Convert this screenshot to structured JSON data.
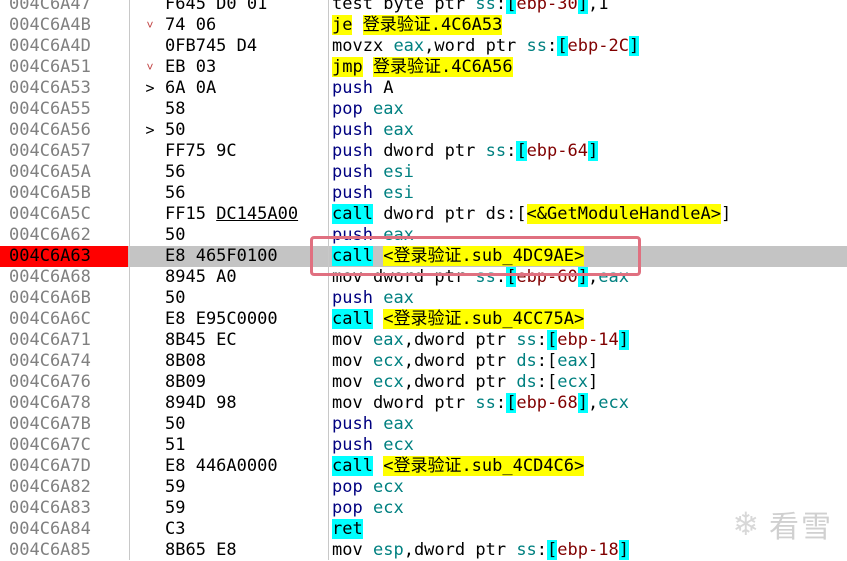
{
  "watermark": {
    "text": "看雪",
    "icon": "snowflake-icon"
  },
  "rows": [
    {
      "addr": "004C6A47",
      "jump": "",
      "bytes": "F645 D0 01",
      "tokens": [
        [
          "kw",
          "test"
        ],
        [
          "sp",
          " "
        ],
        [
          "kw",
          "byte ptr"
        ],
        [
          "sp",
          " "
        ],
        [
          "green",
          "ss"
        ],
        [
          "sp",
          ":"
        ],
        [
          "brk",
          "["
        ],
        [
          "red",
          "ebp-30"
        ],
        [
          "brk",
          "]"
        ],
        [
          "sp",
          ","
        ],
        [
          "kw",
          "1"
        ]
      ]
    },
    {
      "addr": "004C6A4B",
      "jump": "˅",
      "bytes": "74 06",
      "tokens": [
        [
          "yellow",
          "je"
        ],
        [
          "sp",
          " "
        ],
        [
          "yellow",
          "登录验证.4C6A53"
        ]
      ]
    },
    {
      "addr": "004C6A4D",
      "jump": "",
      "bytes": "0FB745 D4",
      "tokens": [
        [
          "kw",
          "movzx"
        ],
        [
          "sp",
          " "
        ],
        [
          "green",
          "eax"
        ],
        [
          "sp",
          ","
        ],
        [
          "kw",
          "word ptr"
        ],
        [
          "sp",
          " "
        ],
        [
          "green",
          "ss"
        ],
        [
          "sp",
          ":"
        ],
        [
          "brk",
          "["
        ],
        [
          "red",
          "ebp-2C"
        ],
        [
          "brk",
          "]"
        ]
      ]
    },
    {
      "addr": "004C6A51",
      "jump": "˅",
      "bytes": "EB 03",
      "tokens": [
        [
          "yellow",
          "jmp"
        ],
        [
          "sp",
          " "
        ],
        [
          "yellow",
          "登录验证.4C6A56"
        ]
      ]
    },
    {
      "addr": "004C6A53",
      "jump": ">",
      "bytes": "6A 0A",
      "tokens": [
        [
          "blue",
          "push"
        ],
        [
          "sp",
          " "
        ],
        [
          "kw",
          "A"
        ]
      ]
    },
    {
      "addr": "004C6A55",
      "jump": "",
      "bytes": "58",
      "tokens": [
        [
          "blue",
          "pop"
        ],
        [
          "sp",
          " "
        ],
        [
          "green",
          "eax"
        ]
      ]
    },
    {
      "addr": "004C6A56",
      "jump": ">",
      "bytes": "50",
      "tokens": [
        [
          "blue",
          "push"
        ],
        [
          "sp",
          " "
        ],
        [
          "green",
          "eax"
        ]
      ]
    },
    {
      "addr": "004C6A57",
      "jump": "",
      "bytes": "FF75 9C",
      "tokens": [
        [
          "blue",
          "push"
        ],
        [
          "sp",
          " "
        ],
        [
          "kw",
          "dword ptr"
        ],
        [
          "sp",
          " "
        ],
        [
          "green",
          "ss"
        ],
        [
          "sp",
          ":"
        ],
        [
          "brk",
          "["
        ],
        [
          "red",
          "ebp-64"
        ],
        [
          "brk",
          "]"
        ]
      ]
    },
    {
      "addr": "004C6A5A",
      "jump": "",
      "bytes": "56",
      "tokens": [
        [
          "blue",
          "push"
        ],
        [
          "sp",
          " "
        ],
        [
          "green",
          "esi"
        ]
      ]
    },
    {
      "addr": "004C6A5B",
      "jump": "",
      "bytes": "56",
      "tokens": [
        [
          "blue",
          "push"
        ],
        [
          "sp",
          " "
        ],
        [
          "green",
          "esi"
        ]
      ]
    },
    {
      "addr": "004C6A5C",
      "jump": "",
      "bytes": "FF15 DC145A00",
      "underline": "DC145A00",
      "tokens": [
        [
          "cyan",
          "call"
        ],
        [
          "sp",
          " "
        ],
        [
          "kw",
          "dword ptr"
        ],
        [
          "sp",
          " "
        ],
        [
          "kw",
          "ds"
        ],
        [
          "sp",
          ":["
        ],
        [
          "yellow",
          "<&GetModuleHandleA>"
        ],
        [
          "sp",
          "]"
        ]
      ]
    },
    {
      "addr": "004C6A62",
      "jump": "",
      "bytes": "50",
      "tokens": [
        [
          "blue",
          "push"
        ],
        [
          "sp",
          " "
        ],
        [
          "green",
          "eax"
        ]
      ]
    },
    {
      "addr": "004C6A63",
      "jump": "",
      "bytes": "E8 465F0100",
      "eip": true,
      "selected": true,
      "tokens": [
        [
          "cyan",
          "call"
        ],
        [
          "sp",
          " "
        ],
        [
          "yellow",
          "<登录验证.sub_4DC9AE>"
        ]
      ]
    },
    {
      "addr": "004C6A68",
      "jump": "",
      "bytes": "8945 A0",
      "tokens": [
        [
          "kw",
          "mov"
        ],
        [
          "sp",
          " "
        ],
        [
          "kw",
          "dword ptr"
        ],
        [
          "sp",
          " "
        ],
        [
          "green",
          "ss"
        ],
        [
          "sp",
          ":"
        ],
        [
          "brk",
          "["
        ],
        [
          "red",
          "ebp-60"
        ],
        [
          "brk",
          "]"
        ],
        [
          "sp",
          ","
        ],
        [
          "green",
          "eax"
        ]
      ]
    },
    {
      "addr": "004C6A6B",
      "jump": "",
      "bytes": "50",
      "tokens": [
        [
          "blue",
          "push"
        ],
        [
          "sp",
          " "
        ],
        [
          "green",
          "eax"
        ]
      ]
    },
    {
      "addr": "004C6A6C",
      "jump": "",
      "bytes": "E8 E95C0000",
      "tokens": [
        [
          "cyan",
          "call"
        ],
        [
          "sp",
          " "
        ],
        [
          "yellow",
          "<登录验证.sub_4CC75A>"
        ]
      ]
    },
    {
      "addr": "004C6A71",
      "jump": "",
      "bytes": "8B45 EC",
      "tokens": [
        [
          "kw",
          "mov"
        ],
        [
          "sp",
          " "
        ],
        [
          "green",
          "eax"
        ],
        [
          "sp",
          ","
        ],
        [
          "kw",
          "dword ptr"
        ],
        [
          "sp",
          " "
        ],
        [
          "green",
          "ss"
        ],
        [
          "sp",
          ":"
        ],
        [
          "brk",
          "["
        ],
        [
          "red",
          "ebp-14"
        ],
        [
          "brk",
          "]"
        ]
      ]
    },
    {
      "addr": "004C6A74",
      "jump": "",
      "bytes": "8B08",
      "tokens": [
        [
          "kw",
          "mov"
        ],
        [
          "sp",
          " "
        ],
        [
          "green",
          "ecx"
        ],
        [
          "sp",
          ","
        ],
        [
          "kw",
          "dword ptr"
        ],
        [
          "sp",
          " "
        ],
        [
          "green",
          "ds"
        ],
        [
          "sp",
          ":["
        ],
        [
          "green",
          "eax"
        ],
        [
          "sp",
          "]"
        ]
      ]
    },
    {
      "addr": "004C6A76",
      "jump": "",
      "bytes": "8B09",
      "tokens": [
        [
          "kw",
          "mov"
        ],
        [
          "sp",
          " "
        ],
        [
          "green",
          "ecx"
        ],
        [
          "sp",
          ","
        ],
        [
          "kw",
          "dword ptr"
        ],
        [
          "sp",
          " "
        ],
        [
          "green",
          "ds"
        ],
        [
          "sp",
          ":["
        ],
        [
          "green",
          "ecx"
        ],
        [
          "sp",
          "]"
        ]
      ]
    },
    {
      "addr": "004C6A78",
      "jump": "",
      "bytes": "894D 98",
      "tokens": [
        [
          "kw",
          "mov"
        ],
        [
          "sp",
          " "
        ],
        [
          "kw",
          "dword ptr"
        ],
        [
          "sp",
          " "
        ],
        [
          "green",
          "ss"
        ],
        [
          "sp",
          ":"
        ],
        [
          "brk",
          "["
        ],
        [
          "red",
          "ebp-68"
        ],
        [
          "brk",
          "]"
        ],
        [
          "sp",
          ","
        ],
        [
          "green",
          "ecx"
        ]
      ]
    },
    {
      "addr": "004C6A7B",
      "jump": "",
      "bytes": "50",
      "tokens": [
        [
          "blue",
          "push"
        ],
        [
          "sp",
          " "
        ],
        [
          "green",
          "eax"
        ]
      ]
    },
    {
      "addr": "004C6A7C",
      "jump": "",
      "bytes": "51",
      "tokens": [
        [
          "blue",
          "push"
        ],
        [
          "sp",
          " "
        ],
        [
          "green",
          "ecx"
        ]
      ]
    },
    {
      "addr": "004C6A7D",
      "jump": "",
      "bytes": "E8 446A0000",
      "tokens": [
        [
          "cyan",
          "call"
        ],
        [
          "sp",
          " "
        ],
        [
          "yellow",
          "<登录验证.sub_4CD4C6>"
        ]
      ]
    },
    {
      "addr": "004C6A82",
      "jump": "",
      "bytes": "59",
      "tokens": [
        [
          "blue",
          "pop"
        ],
        [
          "sp",
          " "
        ],
        [
          "green",
          "ecx"
        ]
      ]
    },
    {
      "addr": "004C6A83",
      "jump": "",
      "bytes": "59",
      "tokens": [
        [
          "blue",
          "pop"
        ],
        [
          "sp",
          " "
        ],
        [
          "green",
          "ecx"
        ]
      ]
    },
    {
      "addr": "004C6A84",
      "jump": "",
      "bytes": "C3",
      "tokens": [
        [
          "cyan",
          "ret"
        ]
      ]
    },
    {
      "addr": "004C6A85",
      "jump": "",
      "bytes": "8B65 E8",
      "tokens": [
        [
          "kw",
          "mov"
        ],
        [
          "sp",
          " "
        ],
        [
          "green",
          "esp"
        ],
        [
          "sp",
          ","
        ],
        [
          "kw",
          "dword ptr"
        ],
        [
          "sp",
          " "
        ],
        [
          "green",
          "ss"
        ],
        [
          "sp",
          ":"
        ],
        [
          "brk",
          "["
        ],
        [
          "red",
          "ebp-18"
        ],
        [
          "brk",
          "]"
        ]
      ]
    }
  ]
}
